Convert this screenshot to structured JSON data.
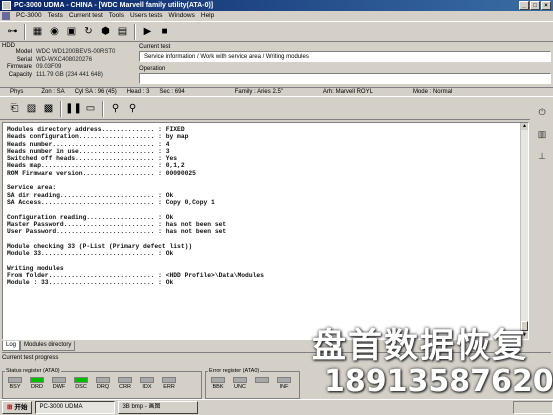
{
  "window": {
    "title": "PC-3000 UDMA - CHINA - [WDC Marvell family utility(ATA-0)]",
    "buttons": [
      "_",
      "□",
      "×"
    ]
  },
  "menu": [
    "PC-3000",
    "Tests",
    "Current test",
    "Tools",
    "Users tests",
    "Windows",
    "Help"
  ],
  "toolbar": {
    "icons": [
      "power-icon",
      "layout-icon",
      "disk-icon",
      "floppy-icon",
      "reset-icon",
      "hex-icon",
      "grid-icon",
      "play-icon",
      "stop-icon"
    ]
  },
  "hdd": {
    "caption": "HDD",
    "model_label": "Model",
    "model": "WDC WD1200BEVS-00RST0",
    "serial_label": "Serial",
    "serial": "WD-WXC408020276",
    "firmware_label": "Firmware",
    "firmware": "09.03F09",
    "capacity_label": "Capacity",
    "capacity": "111.79 GB (234 441 648)"
  },
  "current_test": {
    "caption": "Current test",
    "value": "Service information / Work with service area / Writing modules"
  },
  "operation": {
    "caption": "Operation",
    "value": ""
  },
  "status": {
    "phys": "Phys",
    "zone": "Zon : SA",
    "cyl": "Cyl SA : 96 (45)",
    "head": "Head : 3",
    "sec": "Sec : 694",
    "family": "Family : Aries 2.5\"",
    "arh": "Arh: Marvell ROYL",
    "mode": "Mode : Normal"
  },
  "log_lines": [
    "Modules directory address.............. : FIXED",
    "Heads configuration.................... : by map",
    "Heads number........................... : 4",
    "Heads number in use.................... : 3",
    "Switched off heads..................... : Yes",
    "Heads map.............................. : 0,1,2",
    "ROM Firmware version................... : 00090025",
    "",
    "Service area:",
    "SA dir reading......................... : Ok",
    "SA Access.............................. : Copy 0,Copy 1",
    "",
    "Configuration reading.................. : Ok",
    "Master Password........................ : has not been set",
    "User Password.......................... : has not been set",
    "",
    "Module checking 33 (P-List (Primary defect list))",
    "Module 33.............................. : Ok",
    "",
    "Writing modules",
    "From folder............................ : <HDD Profile>\\Data\\Modules",
    "Module : 33............................ : Ok"
  ],
  "tabs": [
    "Log",
    "Modules directory"
  ],
  "progress_caption": "Current test progress",
  "status_register": {
    "caption": "Status register (ATA0)",
    "flags": [
      {
        "name": "BSY",
        "on": false
      },
      {
        "name": "DRD",
        "on": true
      },
      {
        "name": "DWF",
        "on": false
      },
      {
        "name": "DSC",
        "on": true
      },
      {
        "name": "DRQ",
        "on": false
      },
      {
        "name": "CRR",
        "on": false
      },
      {
        "name": "IDX",
        "on": false
      },
      {
        "name": "ERR",
        "on": false
      }
    ]
  },
  "error_register": {
    "caption": "Error register (ATA0)",
    "flags": [
      {
        "name": "BBK",
        "on": false
      },
      {
        "name": "UNC",
        "on": false
      },
      {
        "name": "",
        "on": false
      },
      {
        "name": "INF",
        "on": false
      }
    ]
  },
  "taskbar": {
    "start": "开始",
    "items": [
      "PC-3000 UDMA",
      "3B bmp - 画图"
    ]
  },
  "watermark": {
    "line1": "盘首数据恢复",
    "line2": "18913587620"
  },
  "colors": {
    "title_start": "#0a246a",
    "title_end": "#3a6ea5",
    "lamp_on": "#00c000",
    "lamp_off": "#a8a8a8"
  }
}
